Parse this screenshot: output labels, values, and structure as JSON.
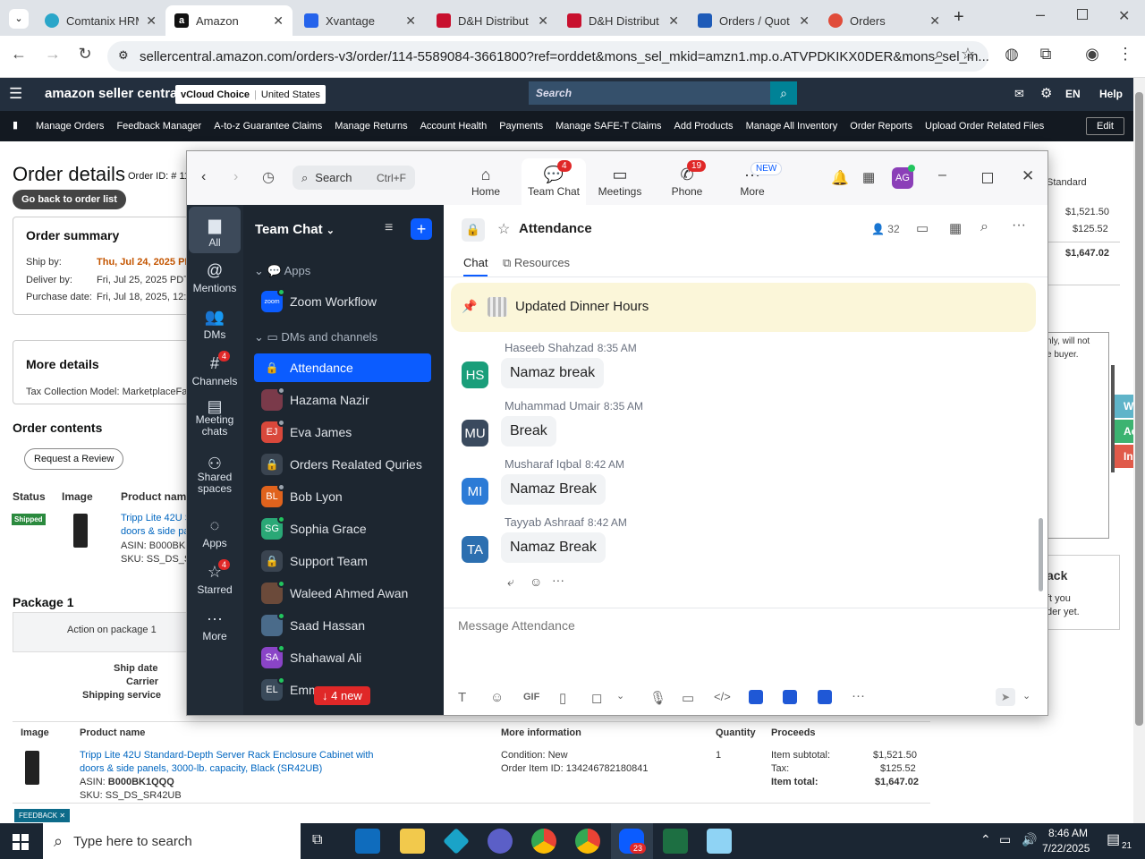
{
  "browser": {
    "tabs": [
      {
        "title": "Comtanix HRM"
      },
      {
        "title": "Amazon"
      },
      {
        "title": "Xvantage"
      },
      {
        "title": "D&H Distribut"
      },
      {
        "title": "D&H Distribut"
      },
      {
        "title": "Orders / Quot"
      },
      {
        "title": "Orders"
      }
    ],
    "url": "sellercentral.amazon.com/orders-v3/order/114-5589084-3661800?ref=orddet&mons_sel_mkid=amzn1.mp.o.ATVPDKIKX0DER&mons_sel_m..."
  },
  "amazon": {
    "logo": "amazon seller central",
    "store": "vCloud Choice",
    "region": "United States",
    "search_placeholder": "Search",
    "lang": "EN",
    "help": "Help",
    "nav": [
      "Manage Orders",
      "Feedback Manager",
      "A-to-z Guarantee Claims",
      "Manage Returns",
      "Account Health",
      "Payments",
      "Manage SAFE-T Claims",
      "Add Products",
      "Manage All Inventory",
      "Order Reports",
      "Upload Order Related Files"
    ],
    "edit": "Edit",
    "page_title": "Order details",
    "order_id_label": "Order ID: # 11",
    "back_button": "Go back to order list",
    "summary_title": "Order summary",
    "ship_by_label": "Ship by:",
    "ship_by": "Thu, Jul 24, 2025 PD",
    "deliver_by_label": "Deliver by:",
    "deliver_by": "Fri, Jul 25, 2025 PDT",
    "purchase_label": "Purchase date:",
    "purchase": "Fri, Jul 18, 2025, 12:1",
    "more_details": "More details",
    "tax_model": "Tax Collection Model:  MarketplaceFac",
    "order_contents": "Order contents",
    "request_review": "Request a Review",
    "col_status": "Status",
    "col_image": "Image",
    "col_product": "Product name",
    "status_badge": "Shipped",
    "prod_line1": "Tripp Lite 42U S",
    "prod_line2": "doors & side pa",
    "asin_short": "ASIN: B000BK1",
    "sku_short": "SKU: SS_DS_SR",
    "package": "Package 1",
    "action_pkg": "Action on package 1",
    "ship_date": "Ship date",
    "carrier": "Carrier",
    "ship_service": "Shipping service",
    "right_standard": "Standard",
    "right_v1": "$1,521.50",
    "right_v2": "$125.52",
    "right_v3": "$1,647.02",
    "right_note1": "nly, will not",
    "right_note2": "e buyer.",
    "right_ack": "ack",
    "right_ft": "ft you",
    "right_der": "der yet.",
    "side_btns": [
      "Wor",
      "Acti",
      "In A"
    ],
    "table2_image": "Image",
    "table2_product": "Product name",
    "table2_info": "More information",
    "table2_qty": "Quantity",
    "table2_proceeds": "Proceeds",
    "full_prod1": "Tripp Lite 42U Standard-Depth Server Rack Enclosure Cabinet with",
    "full_prod2": "doors & side panels, 3000-lb. capacity, Black (SR42UB)",
    "asin_full_label": "ASIN:",
    "asin_full": "B000BK1QQQ",
    "sku_full": "SKU: SS_DS_SR42UB",
    "condition": "Condition: New",
    "order_item": "Order Item ID: 134246782180841",
    "qty": "1",
    "subtotal_label": "Item subtotal:",
    "subtotal": "$1,521.50",
    "tax_label": "Tax:",
    "tax": "$125.52",
    "total_label": "Item total:",
    "total": "$1,647.02",
    "feedback": "FEEDBACK"
  },
  "zoom": {
    "search": "Search",
    "shortcut": "Ctrl+F",
    "top": [
      {
        "label": "Home"
      },
      {
        "label": "Team Chat",
        "badge": "4"
      },
      {
        "label": "Meetings"
      },
      {
        "label": "Phone",
        "badge": "19"
      },
      {
        "label": "More",
        "badge": "NEW"
      }
    ],
    "avatar": "AG",
    "rail": [
      {
        "label": "All"
      },
      {
        "label": "Mentions"
      },
      {
        "label": "DMs"
      },
      {
        "label": "Channels",
        "badge": "4"
      },
      {
        "label": "Meeting chats"
      },
      {
        "label": "Shared spaces"
      },
      {
        "label": "Apps"
      },
      {
        "label": "Starred",
        "badge": "4"
      },
      {
        "label": "More"
      }
    ],
    "panel_title": "Team Chat",
    "section_apps": "Apps",
    "zoom_workflow": "Zoom Workflow",
    "section_dms": "DMs and channels",
    "items": [
      {
        "name": "Attendance",
        "av": "",
        "color": "#0b5cff"
      },
      {
        "name": "Hazama Nazir",
        "av": "",
        "color": "#7a3a4a"
      },
      {
        "name": "Eva James",
        "av": "EJ",
        "color": "#d9483b"
      },
      {
        "name": "Orders Realated Quries",
        "av": "",
        "color": "#3a4450"
      },
      {
        "name": "Bob Lyon",
        "av": "BL",
        "color": "#e0631d"
      },
      {
        "name": "Sophia Grace",
        "av": "SG",
        "color": "#2aa876"
      },
      {
        "name": "Support Team",
        "av": "",
        "color": "#3a4450"
      },
      {
        "name": "Waleed Ahmed Awan",
        "av": "",
        "color": "#6b4a3a"
      },
      {
        "name": "Saad Hassan",
        "av": "",
        "color": "#4a6b8a"
      },
      {
        "name": "Shahawal Ali",
        "av": "SA",
        "color": "#8a44c7"
      },
      {
        "name": "Emm",
        "av": "EL",
        "color": "#3a4a5a"
      }
    ],
    "new_badge": "4 new",
    "channel": "Attendance",
    "members": "32",
    "tab_chat": "Chat",
    "tab_resources": "Resources",
    "pinned": "Updated Dinner Hours",
    "messages": [
      {
        "av": "HS",
        "name": "Haseeb Shahzad",
        "time": "8:35 AM",
        "text": "Namaz break",
        "color": "#1a9e7a"
      },
      {
        "av": "MU",
        "name": "Muhammad Umair",
        "time": "8:35 AM",
        "text": "Break",
        "color": "#3a4a5e"
      },
      {
        "av": "MI",
        "name": "Musharaf Iqbal",
        "time": "8:42 AM",
        "text": "Namaz Break",
        "color": "#2c7bd6"
      },
      {
        "av": "TA",
        "name": "Tayyab Ashraaf",
        "time": "8:42 AM",
        "text": "Namaz Break",
        "color": "#2c6fb0"
      }
    ],
    "compose_placeholder": "Message Attendance",
    "gif": "GIF"
  },
  "taskbar": {
    "search": "Type here to search",
    "zoom_badge": "23",
    "time": "8:46 AM",
    "date": "7/22/2025",
    "notif": "21"
  }
}
